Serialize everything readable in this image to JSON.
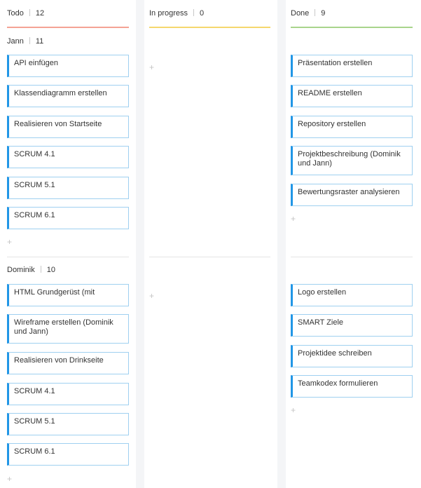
{
  "columns": [
    {
      "title": "Todo",
      "count": "12",
      "color": "#f4a394"
    },
    {
      "title": "In progress",
      "count": "0",
      "color": "#f5d76e"
    },
    {
      "title": "Done",
      "count": "9",
      "color": "#a9d48c"
    }
  ],
  "lanes": [
    {
      "name": "Jann",
      "count": "11",
      "todo": [
        "API einfügen",
        "Klassendiagramm erstellen",
        "Realisieren von Startseite",
        "SCRUM 4.1",
        "SCRUM 5.1",
        "SCRUM 6.1"
      ],
      "done": [
        "Präsentation erstellen",
        "README erstellen",
        "Repository erstellen",
        "Projektbeschreibung (Dominik und Jann)",
        "Bewertungsraster analysieren"
      ]
    },
    {
      "name": "Dominik",
      "count": "10",
      "todo": [
        "HTML Grundgerüst (mit",
        "Wireframe erstellen (Dominik und Jann)",
        "Realisieren von Drinkseite",
        "SCRUM 4.1",
        "SCRUM 5.1",
        "SCRUM 6.1"
      ],
      "done": [
        "Logo erstellen",
        "SMART Ziele",
        "Projektidee schreiben",
        "Teamkodex formulieren"
      ]
    }
  ],
  "add_icon": "+",
  "card_accent_color": "#2196e6"
}
